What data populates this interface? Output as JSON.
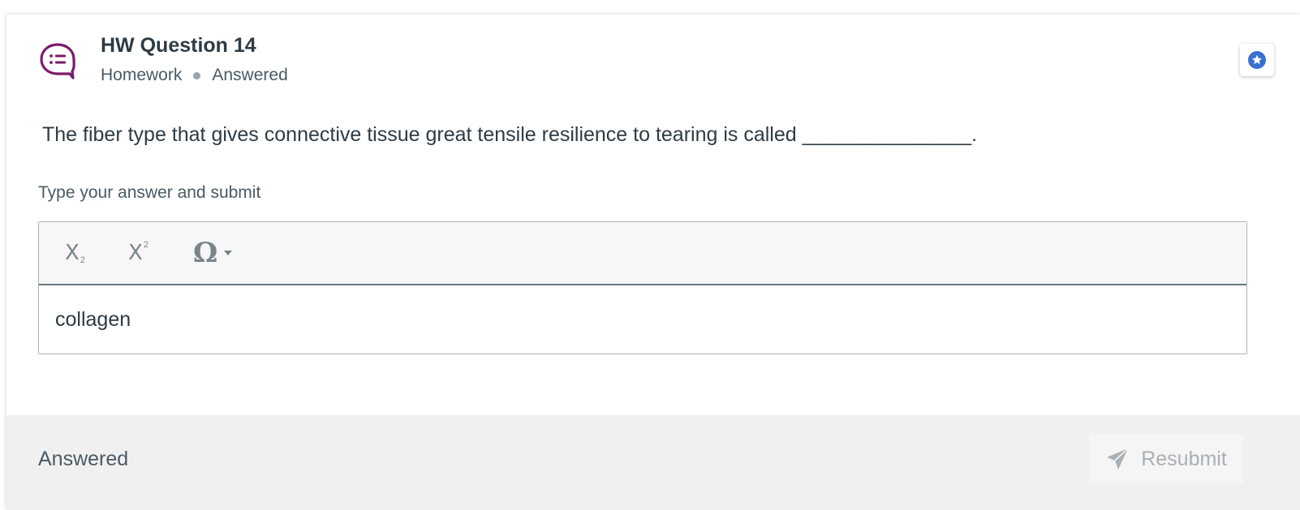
{
  "header": {
    "title": "HW Question 14",
    "category": "Homework",
    "status": "Answered",
    "icon": "chat-list-icon",
    "bookmark_icon": "star-icon"
  },
  "question": {
    "text": "The fiber type that gives connective tissue great tensile resilience to tearing is called _______________."
  },
  "answer": {
    "prompt": "Type your answer and submit",
    "value": "collagen",
    "toolbar": {
      "subscript_label": "X",
      "subscript_mark": "2",
      "superscript_label": "X",
      "superscript_mark": "2",
      "symbol_label": "Ω"
    }
  },
  "footer": {
    "status": "Answered",
    "resubmit_label": "Resubmit",
    "resubmit_icon": "paper-plane-icon"
  },
  "colors": {
    "accent": "#3b6fd4",
    "icon_purple": "#7b1a6b",
    "text": "#2d3b45",
    "muted": "#a8b0b6"
  }
}
